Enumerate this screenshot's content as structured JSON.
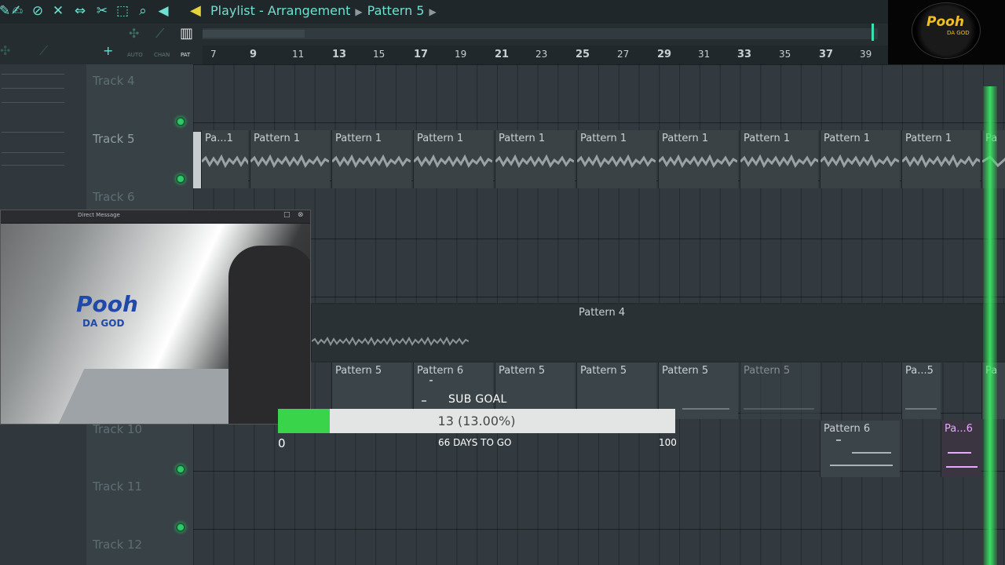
{
  "header": {
    "title": "Playlist - Arrangement",
    "pattern": "Pattern 5"
  },
  "subbar": {
    "labels": [
      "AUTO",
      "CHAN",
      "PAT"
    ]
  },
  "ruler": {
    "numbers": [
      "7",
      "9",
      "11",
      "13",
      "15",
      "17",
      "19",
      "21",
      "23",
      "25",
      "27",
      "29",
      "31",
      "33",
      "35",
      "37",
      "39"
    ]
  },
  "logo": {
    "main": "Pooh",
    "sub": "DA GOD"
  },
  "tracks": [
    {
      "name": "Track 4"
    },
    {
      "name": "Track 5"
    },
    {
      "name": "Track 6"
    },
    {
      "name": "Track 10"
    },
    {
      "name": "Track 11"
    },
    {
      "name": "Track 12"
    }
  ],
  "clips": {
    "track5": [
      "Pa...1",
      "Pattern 1",
      "Pattern 1",
      "Pattern 1",
      "Pattern 1",
      "Pattern 1",
      "Pattern 1",
      "Pattern 1",
      "Pattern 1",
      "Pattern 1",
      "Pa"
    ],
    "track8": "Pattern 4",
    "track9": [
      "Pattern 5",
      "Pattern 6",
      "Pattern 5",
      "Pattern 5",
      "Pattern 5",
      "Pattern 5",
      "Pa...5",
      "Pa"
    ],
    "track10": [
      "Pattern 6",
      "Pa...6"
    ]
  },
  "webcam": {
    "title": "Direct Message",
    "logo": "Pooh",
    "logo_sub": "DA GOD"
  },
  "goal": {
    "title": "SUB GOAL",
    "value_text": "13 (13.00%)",
    "progress": 0.13,
    "min": "0",
    "max": "100",
    "days": "66 DAYS TO GO"
  },
  "colors": {
    "accent": "#6fe0cf",
    "title_arrow": "#e6d23a",
    "led": "#2eca6a",
    "goal_fill": "#39d44a",
    "playhead": "#3cf064",
    "logo": "#f0c020"
  }
}
